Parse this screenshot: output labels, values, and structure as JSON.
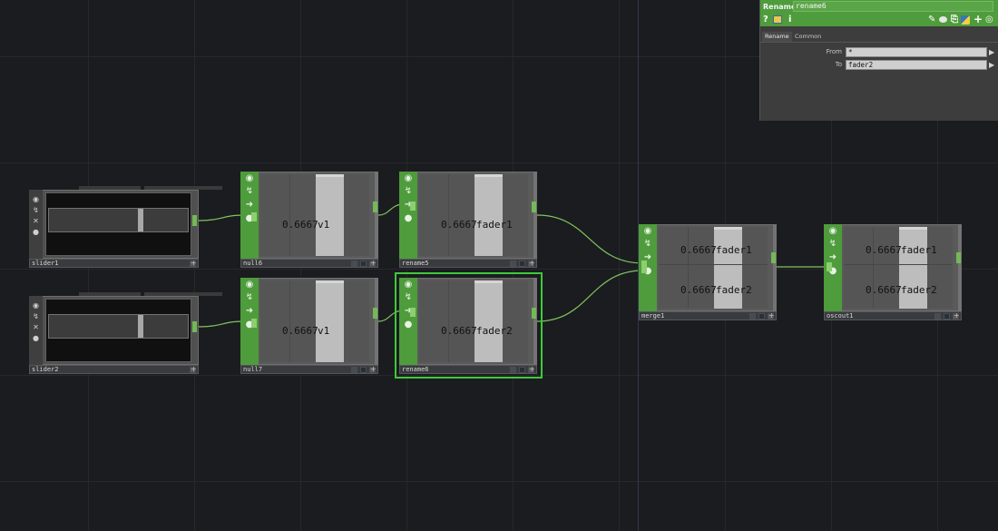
{
  "network": {
    "nodes": {
      "slider1": {
        "label": "slider1"
      },
      "slider2": {
        "label": "slider2"
      },
      "null6": {
        "label": "null6",
        "value": "0.6667",
        "channel": "v1"
      },
      "null7": {
        "label": "null7",
        "value": "0.6667",
        "channel": "v1"
      },
      "rename5": {
        "label": "rename5",
        "value": "0.6667",
        "channel": "fader1"
      },
      "rename6": {
        "label": "rename6",
        "value": "0.6667",
        "channel": "fader2",
        "selected": true
      },
      "merge1": {
        "label": "merge1",
        "channels": [
          {
            "value": "0.6667",
            "channel": "fader1"
          },
          {
            "value": "0.6667",
            "channel": "fader2"
          }
        ]
      },
      "oscout1": {
        "label": "oscout1",
        "channels": [
          {
            "value": "0.6667",
            "channel": "fader1"
          },
          {
            "value": "0.6667",
            "channel": "fader2"
          }
        ]
      }
    },
    "slider_level": 0.67,
    "colors": {
      "chop_green": "#4e9c3c",
      "selection": "#3fc93b",
      "wire": "#7fc35f"
    }
  },
  "params": {
    "op_type": "Rename",
    "op_name": "rename6",
    "header_icons": [
      "help-icon",
      "python-icon",
      "info-icon",
      "edit-icon",
      "comment-icon",
      "clone-icon",
      "python-logo-icon",
      "add-icon",
      "target-icon"
    ],
    "tabs": [
      "Rename",
      "Common"
    ],
    "active_tab": "Rename",
    "fields": {
      "from_label": "From",
      "from_value": "*",
      "to_label": "To",
      "to_value": "fader2"
    }
  }
}
